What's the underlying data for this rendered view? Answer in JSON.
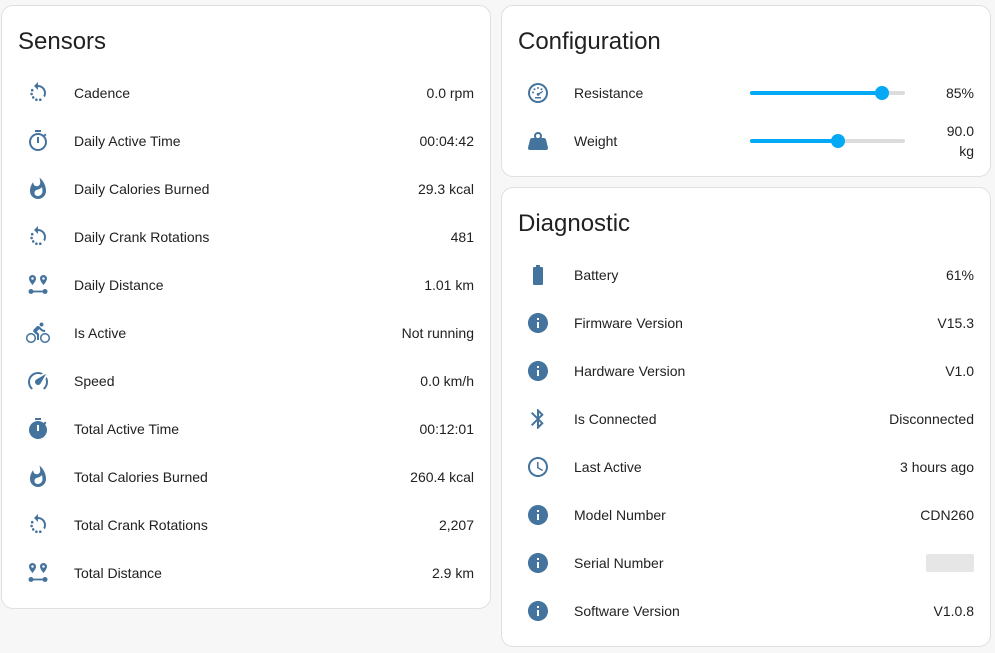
{
  "sensors": {
    "title": "Sensors",
    "items": [
      {
        "label": "Cadence",
        "value": "0.0 rpm",
        "icon": "rotate-dashed-icon"
      },
      {
        "label": "Daily Active Time",
        "value": "00:04:42",
        "icon": "timer-outline-icon"
      },
      {
        "label": "Daily Calories Burned",
        "value": "29.3 kcal",
        "icon": "fire-icon"
      },
      {
        "label": "Daily Crank Rotations",
        "value": "481",
        "icon": "rotate-dashed-icon"
      },
      {
        "label": "Daily Distance",
        "value": "1.01 km",
        "icon": "map-marker-distance-icon"
      },
      {
        "label": "Is Active",
        "value": "Not running",
        "icon": "bike-icon"
      },
      {
        "label": "Speed",
        "value": "0.0 km/h",
        "icon": "speedometer-icon"
      },
      {
        "label": "Total Active Time",
        "value": "00:12:01",
        "icon": "timer-icon"
      },
      {
        "label": "Total Calories Burned",
        "value": "260.4 kcal",
        "icon": "fire-icon"
      },
      {
        "label": "Total Crank Rotations",
        "value": "2,207",
        "icon": "rotate-dashed-icon"
      },
      {
        "label": "Total Distance",
        "value": "2.9 km",
        "icon": "map-marker-distance-icon"
      }
    ]
  },
  "configuration": {
    "title": "Configuration",
    "resistance": {
      "label": "Resistance",
      "value": "85%",
      "level": 0.85,
      "icon": "gauge-icon"
    },
    "weight": {
      "label": "Weight",
      "value_num": "90.0",
      "value_unit": "kg",
      "level": 0.57,
      "icon": "weight-icon"
    }
  },
  "diagnostic": {
    "title": "Diagnostic",
    "items": [
      {
        "label": "Battery",
        "value": "61%",
        "icon": "battery-icon"
      },
      {
        "label": "Firmware Version",
        "value": "V15.3",
        "icon": "information-icon"
      },
      {
        "label": "Hardware Version",
        "value": "V1.0",
        "icon": "information-icon"
      },
      {
        "label": "Is Connected",
        "value": "Disconnected",
        "icon": "bluetooth-icon"
      },
      {
        "label": "Last Active",
        "value": "3 hours ago",
        "icon": "clock-outline-icon"
      },
      {
        "label": "Model Number",
        "value": "CDN260",
        "icon": "information-icon"
      },
      {
        "label": "Serial Number",
        "value": "",
        "icon": "information-icon"
      },
      {
        "label": "Software Version",
        "value": "V1.0.8",
        "icon": "information-icon"
      }
    ]
  },
  "colors": {
    "icon": "#44739e",
    "slider": "#03a9f4",
    "track": "#dcdcdc",
    "background": "#f7f7f7"
  }
}
